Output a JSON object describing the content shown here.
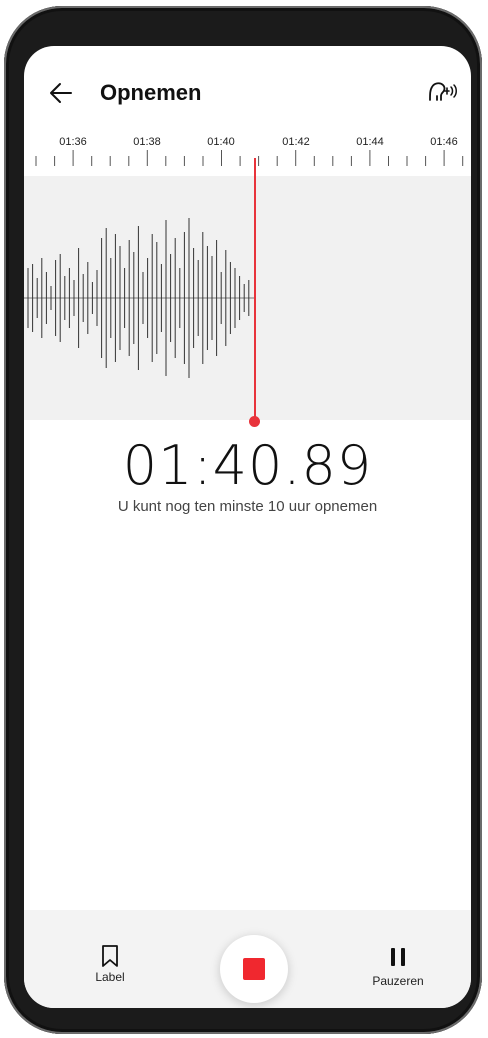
{
  "header": {
    "title": "Opnemen",
    "back_icon": "arrow-left-icon",
    "voice_icon": "voice-speaker-icon"
  },
  "ruler": {
    "labels": [
      "01:36",
      "01:38",
      "01:40",
      "01:42",
      "01:44",
      "01:46"
    ]
  },
  "recording": {
    "elapsed": "01:40.89",
    "remaining_text": "U kunt nog ten minste 10 uur opnemen",
    "playhead_color": "#e8333b"
  },
  "controls": {
    "label_text": "Label",
    "label_icon": "bookmark-icon",
    "stop_icon": "stop-icon",
    "stop_color": "#f0282f",
    "pause_text": "Pauzeren",
    "pause_icon": "pause-icon"
  }
}
